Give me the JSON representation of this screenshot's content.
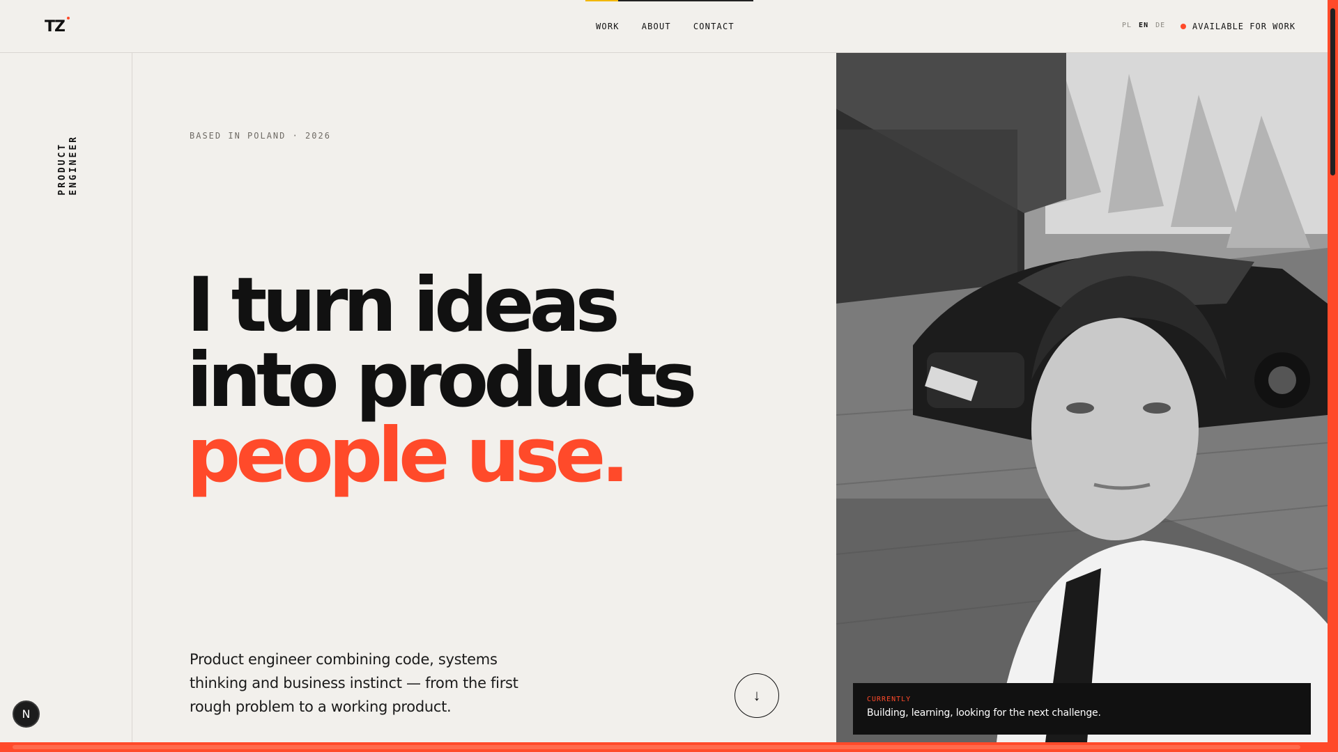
{
  "header": {
    "logo": "TZ",
    "nav": [
      "WORK",
      "ABOUT",
      "CONTACT"
    ],
    "languages": [
      "PL",
      "EN",
      "DE"
    ],
    "active_language": "EN",
    "availability": "AVAILABLE FOR WORK"
  },
  "rail": {
    "label": "PRODUCT\nENGINEER"
  },
  "hero": {
    "eyebrow": "BASED IN POLAND · 2026",
    "headline_line1": "I turn ideas",
    "headline_line2": "into products",
    "headline_accent": "people use.",
    "intro": "Product engineer combining code, systems thinking and business instinct — from the first rough problem to a working product.",
    "scroll_icon": "↓"
  },
  "photo": {
    "caption_label": "CURRENTLY",
    "caption_text": "Building, learning, looking for the next challenge."
  },
  "badge": {
    "letter": "N"
  },
  "colors": {
    "accent": "#ff4a2a",
    "background": "#f2f0ec",
    "text": "#111111",
    "nav_progress": "#f2b705"
  }
}
